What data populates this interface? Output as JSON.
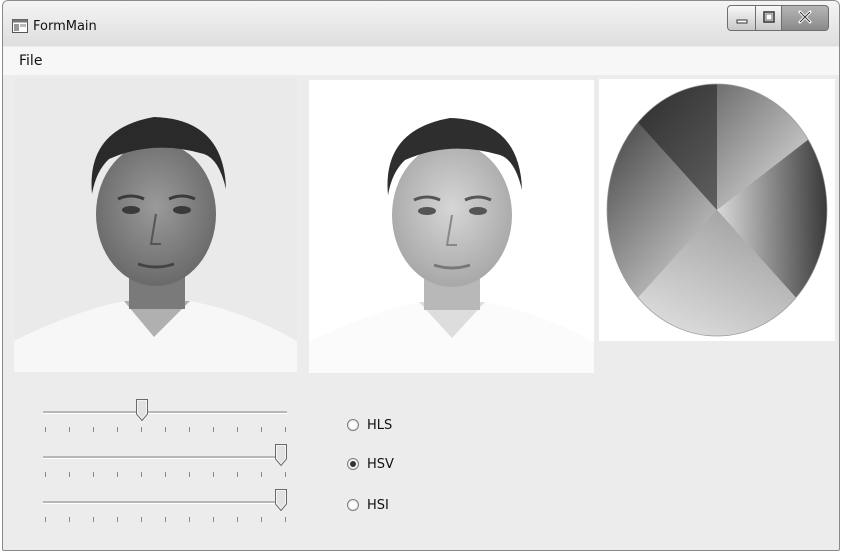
{
  "window": {
    "title": "FormMain"
  },
  "menu": {
    "items": [
      {
        "label": "File"
      }
    ]
  },
  "sliders": [
    {
      "name": "slider-1",
      "value": 0.4,
      "ticks": 11
    },
    {
      "name": "slider-2",
      "value": 1.0,
      "ticks": 11
    },
    {
      "name": "slider-3",
      "value": 1.0,
      "ticks": 11
    }
  ],
  "color_space": {
    "options": [
      {
        "label": "HLS",
        "selected": false
      },
      {
        "label": "HSV",
        "selected": true
      },
      {
        "label": "HSI",
        "selected": false
      }
    ]
  },
  "icons": {
    "app": "form-app-icon",
    "minimize": "minimize-icon",
    "maximize": "maximize-icon",
    "close": "close-icon"
  }
}
